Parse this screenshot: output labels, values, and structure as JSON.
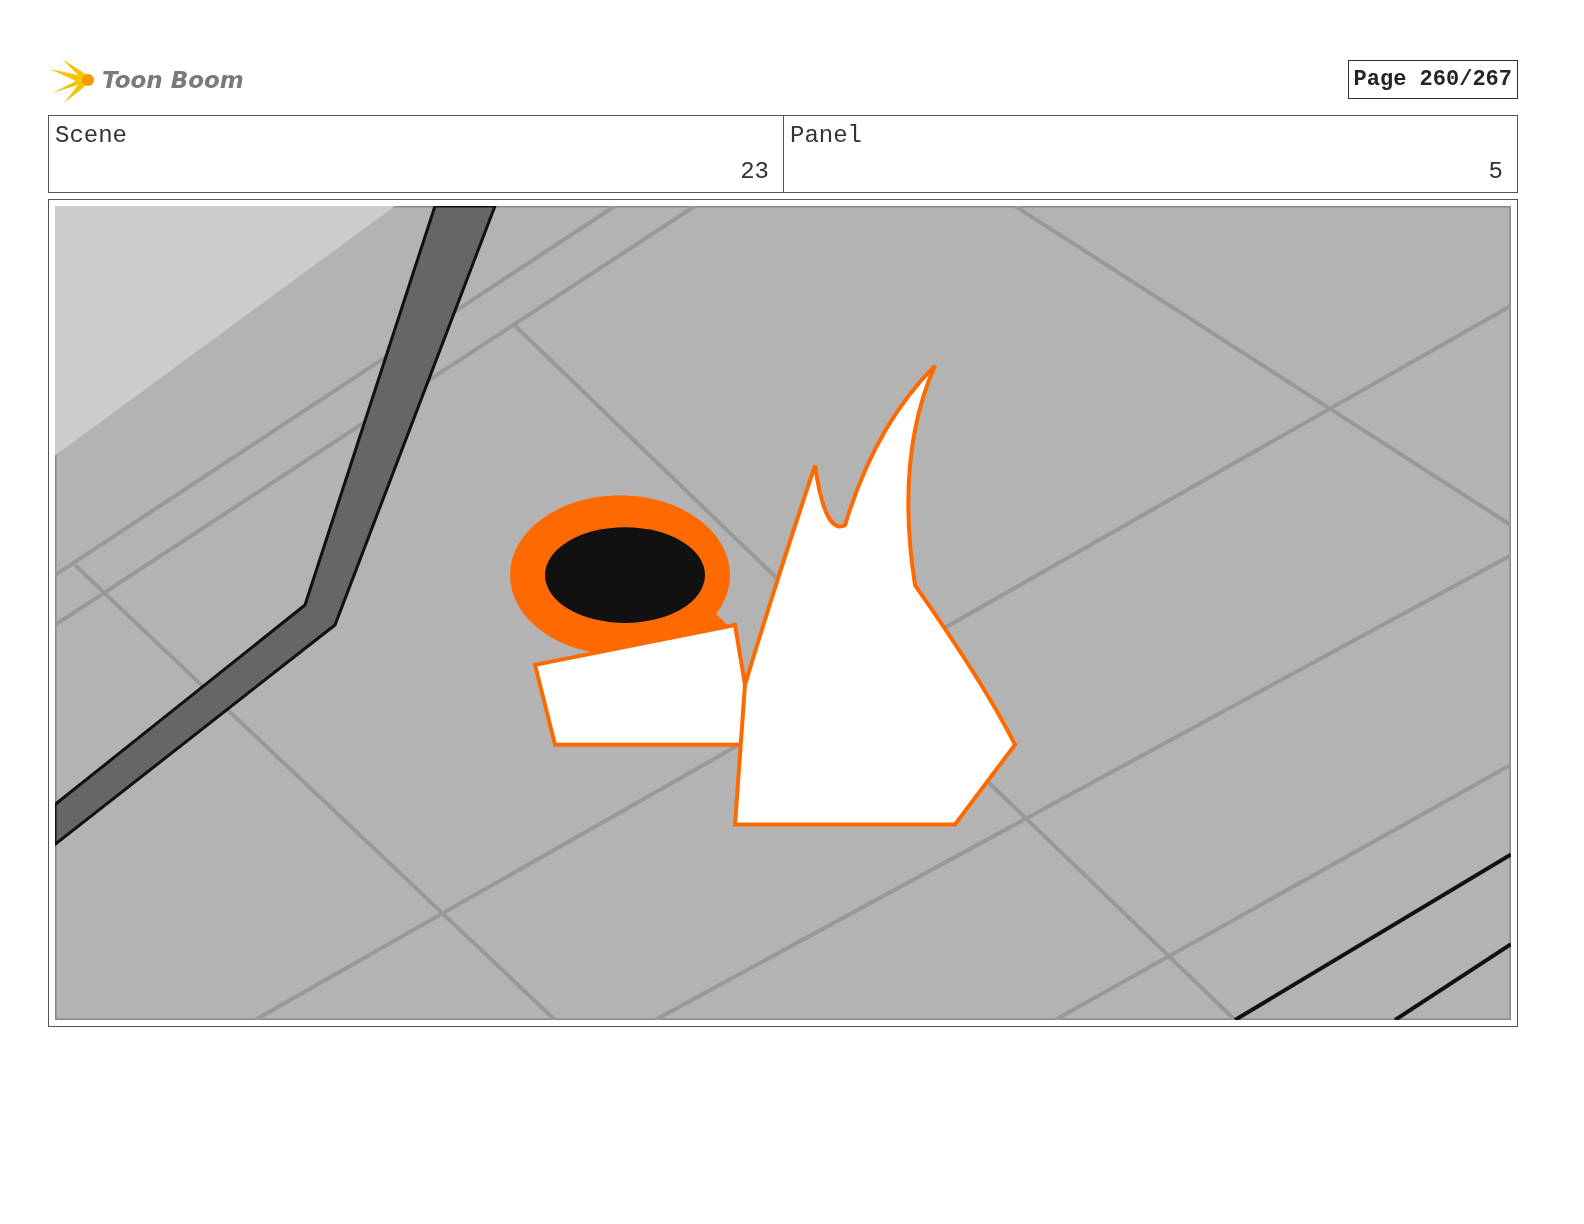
{
  "header": {
    "logo_text": "Toon Boom",
    "page": "Page 260/267"
  },
  "fields": [
    {
      "label": "Scene",
      "value": "23"
    },
    {
      "label": "Panel",
      "value": "5"
    }
  ]
}
